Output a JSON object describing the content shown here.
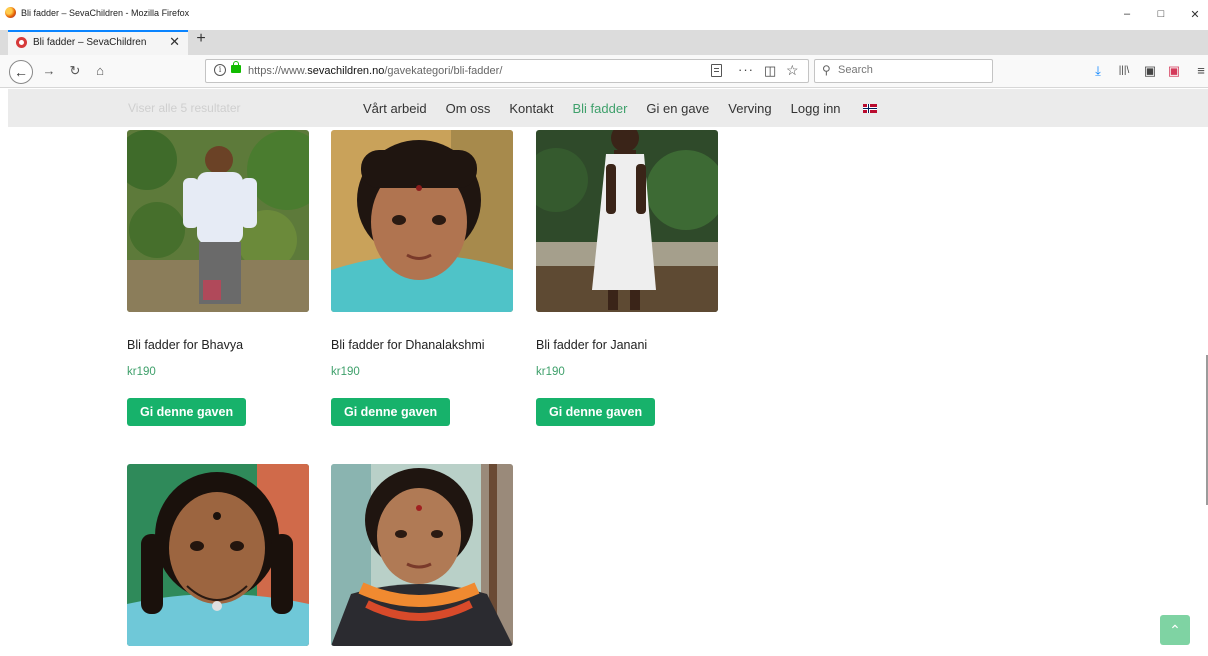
{
  "window": {
    "title": "Bli fadder – SevaChildren - Mozilla Firefox",
    "controls": {
      "minimize": "–",
      "maximize": "□",
      "close": "✕"
    }
  },
  "tab": {
    "label": "Bli fadder – SevaChildren",
    "close": "✕",
    "new_tab": "+"
  },
  "toolbar": {
    "back": "←",
    "forward": "→",
    "reload": "↻",
    "home": "⌂",
    "url_prefix": "https://www.",
    "url_domain": "sevachildren.no",
    "url_path": "/gavekategori/bli-fadder/",
    "more": "···",
    "pocket": "◫",
    "star": "☆",
    "search_placeholder": "Search",
    "icons": {
      "download": "⤓",
      "library": "|||\\",
      "sidebar": "▣",
      "pocket_menu": "▣",
      "menu": "≡"
    }
  },
  "site": {
    "result_count": "Viser alle 5 resultater",
    "menu": [
      {
        "label": "Vårt arbeid",
        "active": false
      },
      {
        "label": "Om oss",
        "active": false
      },
      {
        "label": "Kontakt",
        "active": false
      },
      {
        "label": "Bli fadder",
        "active": true
      },
      {
        "label": "Gi en gave",
        "active": false
      },
      {
        "label": "Verving",
        "active": false
      },
      {
        "label": "Logg inn",
        "active": false
      }
    ],
    "language_flag": "norway-flag-icon",
    "accent_color": "#17b26b",
    "price_color": "#3fa06b"
  },
  "products": [
    {
      "name": "Bli fadder for Bhavya",
      "price": "kr190",
      "button": "Gi denne gaven"
    },
    {
      "name": "Bli fadder for Dhanalakshmi",
      "price": "kr190",
      "button": "Gi denne gaven"
    },
    {
      "name": "Bli fadder for Janani",
      "price": "kr190",
      "button": "Gi denne gaven"
    }
  ],
  "scroll_top": "⌃"
}
